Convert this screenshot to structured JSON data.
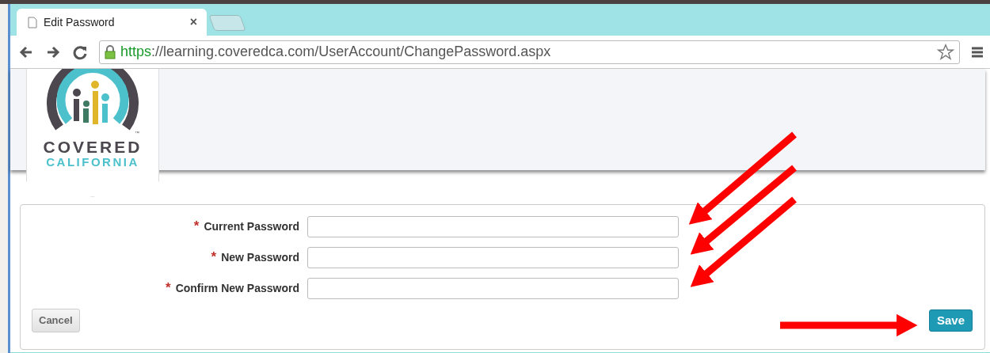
{
  "browser": {
    "tab_title": "Edit Password",
    "tab_close": "×",
    "url_scheme": "https",
    "url_sep": "://",
    "url_host": "learning.coveredca.com",
    "url_path": "/UserAccount/ChangePassword.aspx"
  },
  "logo": {
    "line1": "COVERED",
    "line2": "CALIFORNIA",
    "trademark": "™"
  },
  "fields": [
    {
      "label": "Current Password",
      "required_mark": "*"
    },
    {
      "label": "New Password",
      "required_mark": "*"
    },
    {
      "label": "Confirm New Password",
      "required_mark": "*"
    }
  ],
  "buttons": [
    {
      "label": "Cancel",
      "kind": "secondary"
    },
    {
      "label": "Save",
      "kind": "primary"
    }
  ]
}
